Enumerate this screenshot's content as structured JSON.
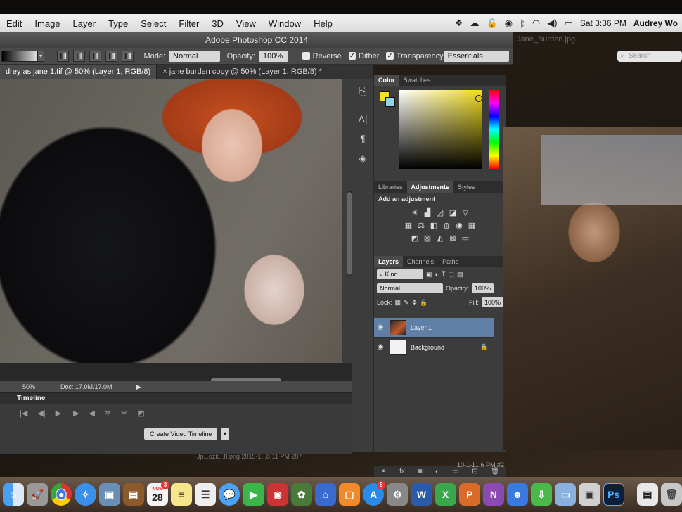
{
  "menubar": {
    "items": [
      "Edit",
      "Image",
      "Layer",
      "Type",
      "Select",
      "Filter",
      "3D",
      "View",
      "Window",
      "Help"
    ],
    "clock": "Sat 3:36 PM",
    "user": "Audrey Wo"
  },
  "app": {
    "title": "Adobe Photoshop CC 2014"
  },
  "options": {
    "mode_label": "Mode:",
    "mode_value": "Normal",
    "opacity_label": "Opacity:",
    "opacity_value": "100%",
    "reverse_label": "Reverse",
    "dither_label": "Dither",
    "transparency_label": "Transparency",
    "workspace": "Essentials"
  },
  "tabs": [
    {
      "label": "drey as jane 1.tif @ 50% (Layer 1, RGB/8)"
    },
    {
      "label": "jane burden copy @ 50% (Layer 1, RGB/8) *"
    }
  ],
  "status": {
    "zoom": "50%",
    "doc": "Doc: 17.0M/17.0M"
  },
  "timeline": {
    "title": "Timeline",
    "create_label": "Create Video Timeline"
  },
  "panels": {
    "color_tabs": [
      "Color",
      "Swatches"
    ],
    "adj_tabs": [
      "Libraries",
      "Adjustments",
      "Styles"
    ],
    "adj_title": "Add an adjustment",
    "layer_tabs": [
      "Layers",
      "Channels",
      "Paths"
    ],
    "kind": "Kind",
    "blend": "Normal",
    "opacity_label": "Opacity:",
    "opacity_value": "100%",
    "lock_label": "Lock:",
    "fill_label": "Fill:",
    "fill_value": "100%",
    "layers": [
      {
        "name": "Layer 1"
      },
      {
        "name": "Background"
      }
    ]
  },
  "finder": {
    "title": "Jane_Burden.jpg",
    "search_placeholder": "Search",
    "caption": "10-1-1...6 PM #2"
  },
  "bg_caption": "Jp...qzk...8.png   2015-1...8.11 PM   207",
  "dock": {
    "calendar_day": "28",
    "calendar_month": "NOV",
    "mail_badge": "3",
    "appstore_badge": "5",
    "ps_label": "Ps"
  },
  "colors": {
    "fg": "#f4e01e",
    "bg": "#8fd7e8",
    "selected_layer": "#5f7fa6"
  }
}
